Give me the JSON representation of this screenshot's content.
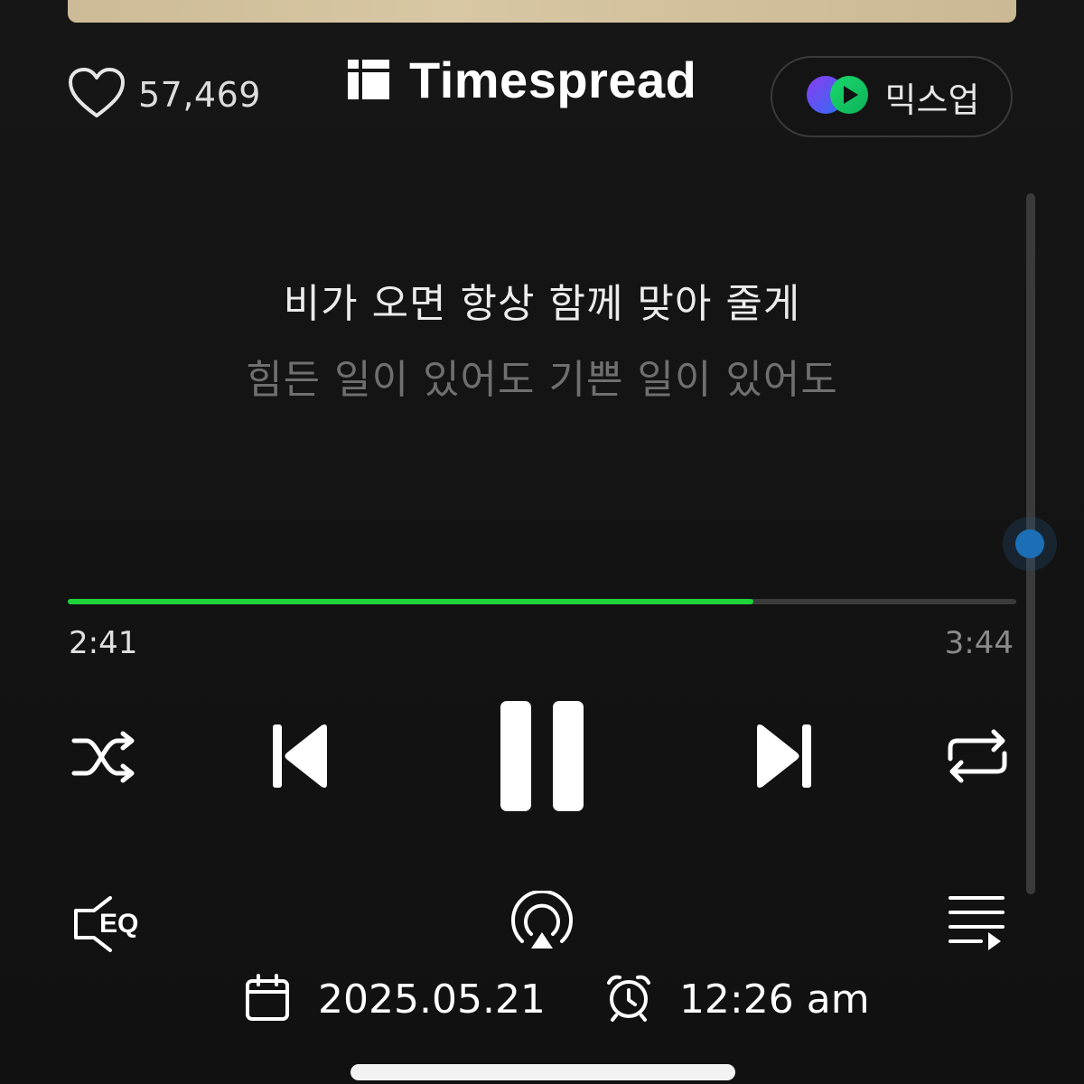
{
  "header": {
    "like_count": "57,469",
    "brand_name": "Timespread",
    "mixup_label": "믹스업"
  },
  "lyrics": {
    "current_line": "비가 오면 항상 함께 맞아 줄게",
    "next_line": "힘든 일이 있어도 기쁜 일이 있어도"
  },
  "playback": {
    "current_time": "2:41",
    "total_time": "3:44",
    "progress_fraction": 0.7232,
    "state": "playing"
  },
  "footer": {
    "date": "2025.05.21",
    "time": "12:26 am",
    "eq_label": "EQ"
  },
  "colors": {
    "progress": "#1fd33a",
    "scroll_accent": "#1d6fb5",
    "background": "#141414"
  },
  "icons": [
    "heart-icon",
    "brand-logo-icon",
    "mixup-icon",
    "shuffle-icon",
    "previous-icon",
    "pause-icon",
    "next-icon",
    "repeat-icon",
    "eq-icon",
    "airplay-icon",
    "playlist-icon",
    "calendar-icon",
    "alarm-clock-icon"
  ]
}
